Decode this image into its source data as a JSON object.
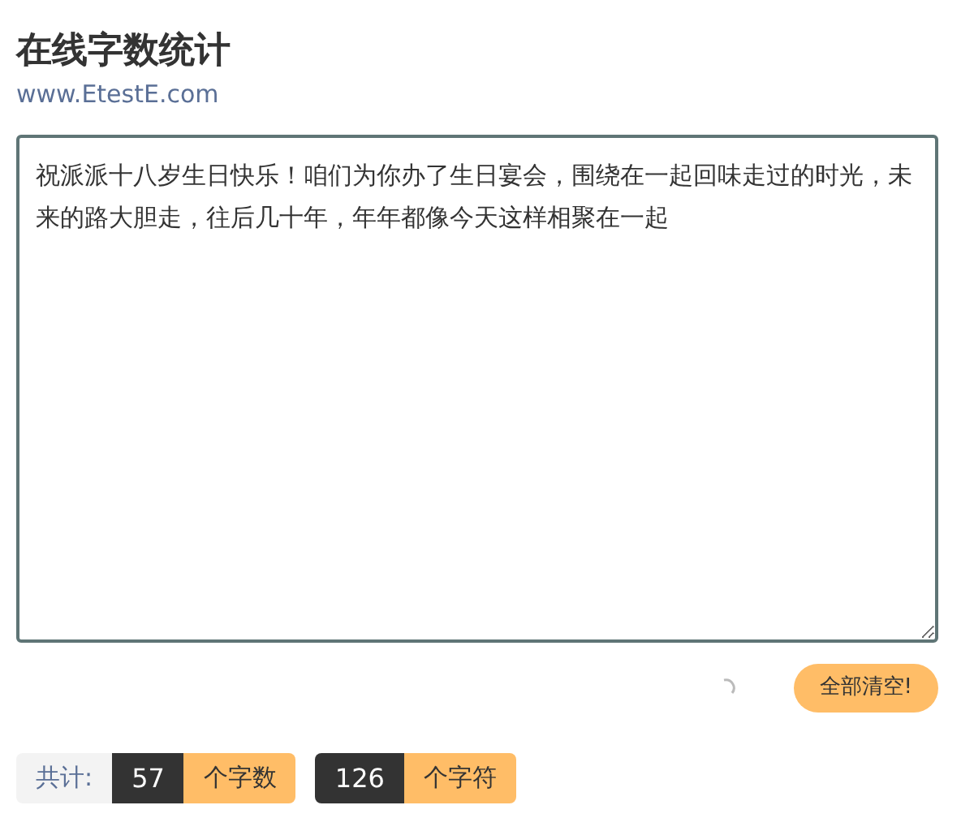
{
  "title": "在线字数统计",
  "site": "www.EtestE.com",
  "editor": {
    "value": "祝派派十八岁生日快乐！咱们为你办了生日宴会，围绕在一起回味走过的时光，未来的路大胆走，往后几十年，年年都像今天这样相聚在一起"
  },
  "clear_button": "全部清空!",
  "totals": {
    "label": "共计:",
    "counts": [
      {
        "value": "57",
        "unit": "个字数"
      },
      {
        "value": "126",
        "unit": "个字符"
      }
    ]
  }
}
